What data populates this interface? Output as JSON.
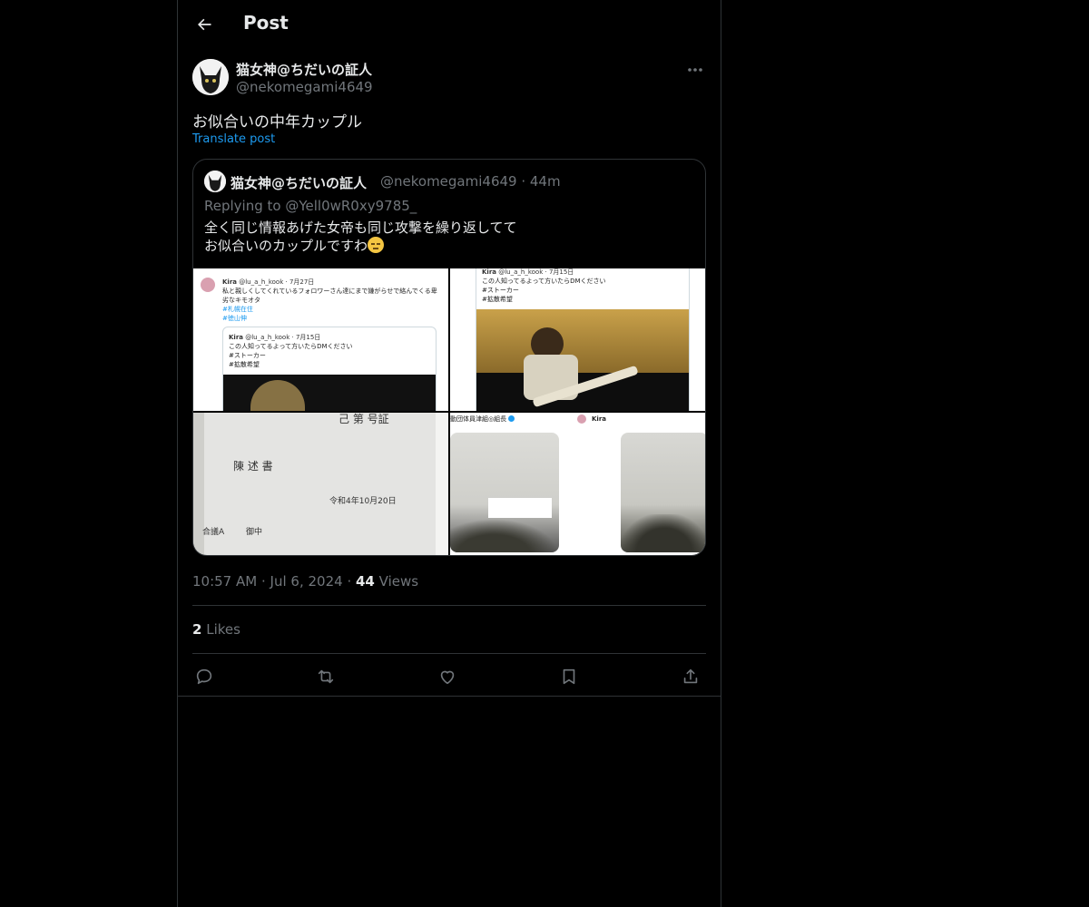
{
  "header": {
    "title": "Post"
  },
  "post": {
    "author_name": "猫女神@ちだいの証人",
    "author_handle": "@nekomegami4649",
    "text": "お似合いの中年カップル",
    "translate_label": "Translate post"
  },
  "quote": {
    "author_name": "猫女神@ちだいの証人",
    "author_handle": "@nekomegami4649",
    "time": "44m",
    "replying_prefix": "Replying to ",
    "replying_to": "@Yell0wR0xy9785_",
    "text_line1": "全く同じ情報あげた女帝も同じ攻撃を繰り返してて",
    "text_line2": "お似合いのカップルですわ",
    "media": [
      {
        "author": "Kira",
        "handle": "@lu_a_h_kook · 7月27日",
        "text1": "私と親しくしてくれているフォロワーさん達にまで嫌がらせで絡んでくる卑",
        "text2": "劣なキモオタ",
        "tag1": "#札幌在住",
        "tag2": "#徳山伸",
        "inner_author": "Kira",
        "inner_handle": "@lu_a_h_kook · 7月15日",
        "inner_text": "この人知ってるよって方いたらDMください",
        "inner_tag1": "#ストーカー",
        "inner_tag2": "#拡散希望"
      },
      {
        "author": "Kira",
        "handle": "@lu_a_h_kook · 7月15日",
        "text": "この人知ってるよって方いたらDMください",
        "tag1": "#ストーカー",
        "tag2": "#拡散希望"
      },
      {
        "line1": "己  第   号証",
        "title": "陳  述  書",
        "date": "令和4年10月20日",
        "addressee": "合議A",
        "addressee_suffix": "御中"
      },
      {
        "account": "動団体員津組◎組長",
        "author": "Kira"
      }
    ]
  },
  "meta": {
    "time": "10:57 AM",
    "date": "Jul 6, 2024",
    "views_count": "44",
    "views_label": "Views"
  },
  "likes": {
    "count": "2",
    "label": "Likes"
  },
  "colors": {
    "background": "#000000",
    "text": "#e7e9ea",
    "muted": "#71767b",
    "link": "#1d9bf0",
    "border": "#2f3336"
  },
  "icons": [
    "back-arrow-icon",
    "more-icon",
    "reply-icon",
    "repost-icon",
    "like-icon",
    "bookmark-icon",
    "share-icon"
  ]
}
